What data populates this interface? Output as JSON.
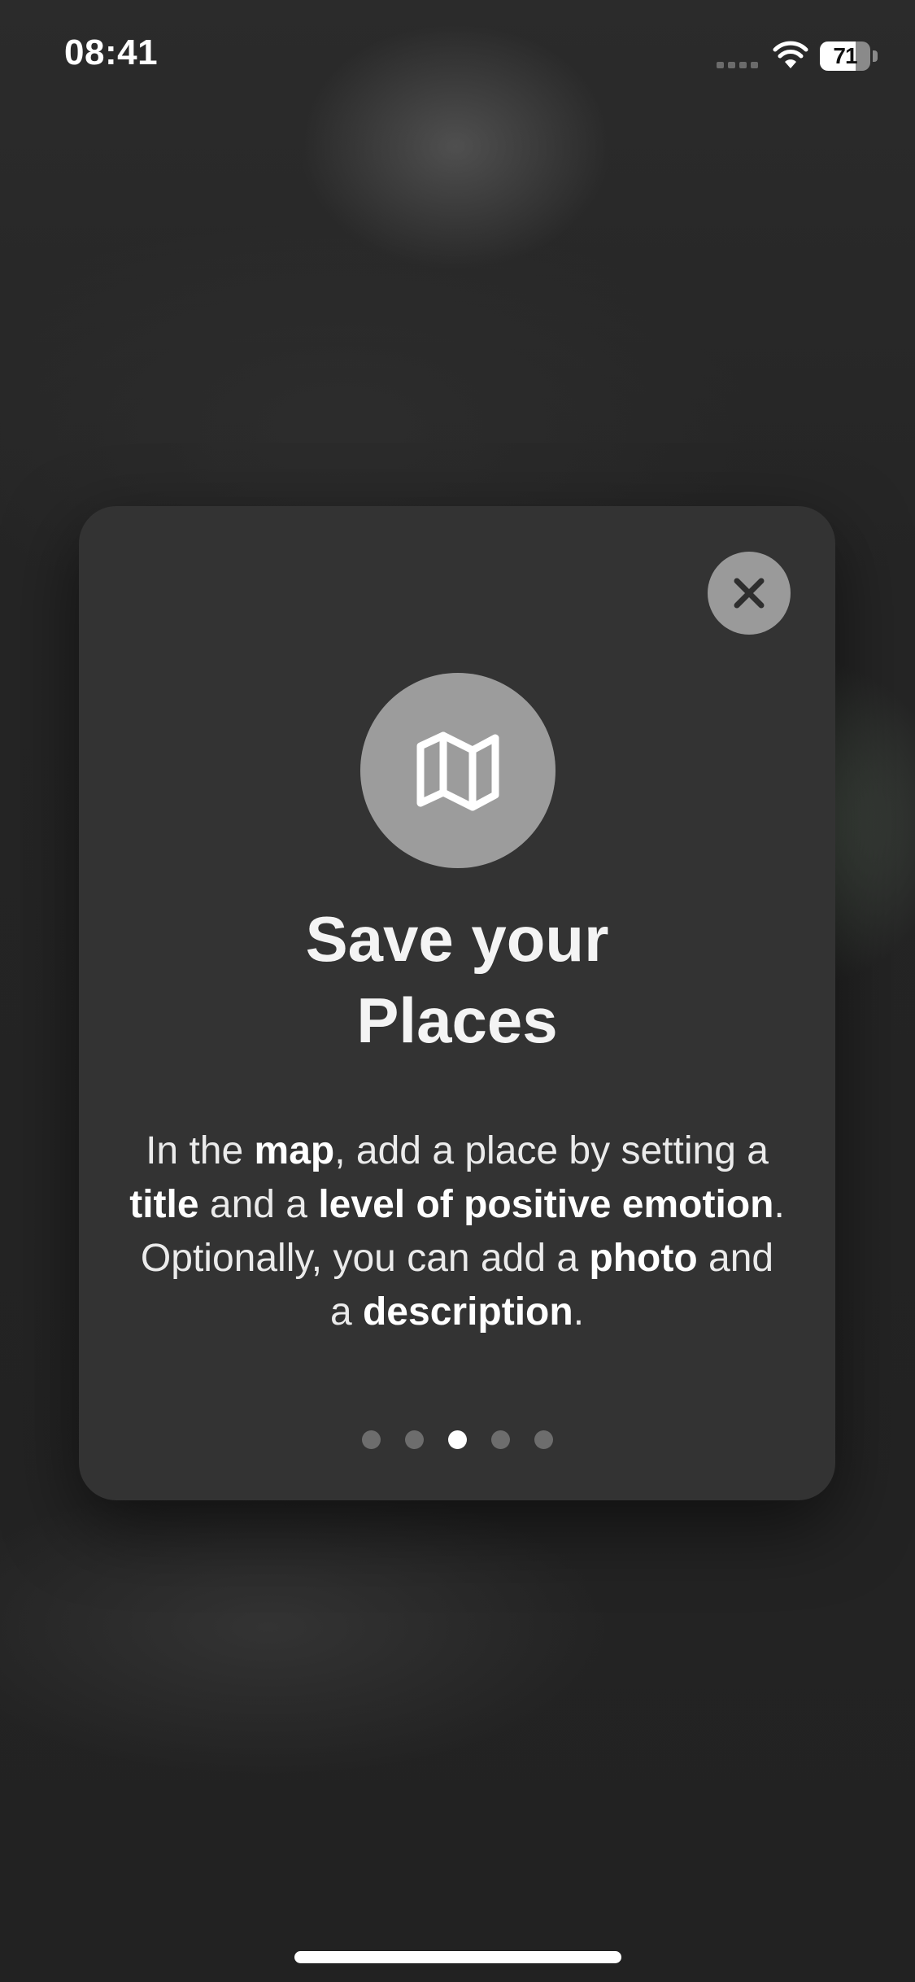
{
  "status_bar": {
    "time": "08:41",
    "battery": "71",
    "icons": [
      "cellular-signal-icon",
      "wifi-icon",
      "battery-icon"
    ]
  },
  "card": {
    "close_icon": "close-icon",
    "feature_icon": "map-icon",
    "title_lines": [
      "Save your",
      "Places"
    ],
    "description": {
      "line1": {
        "t1": "In the ",
        "b1": "map",
        "t2": ", add a place by setting a"
      },
      "line2": {
        "b1": "title",
        "t1": " and a ",
        "b2": "level of positive emotion",
        "t2": "."
      },
      "line3": {
        "t1": "Optionally, you can add a ",
        "b1": "photo",
        "t2": " and"
      },
      "line4": {
        "t1": "a ",
        "b1": "description",
        "t2": "."
      }
    },
    "pager": {
      "total": 5,
      "active_index": 2
    }
  },
  "colors": {
    "card_background": "#333333",
    "icon_circle": "#9c9c9c",
    "close_button": "#9a9a9a",
    "active_dot": "#ffffff",
    "inactive_dot": "#6d6d6d"
  }
}
